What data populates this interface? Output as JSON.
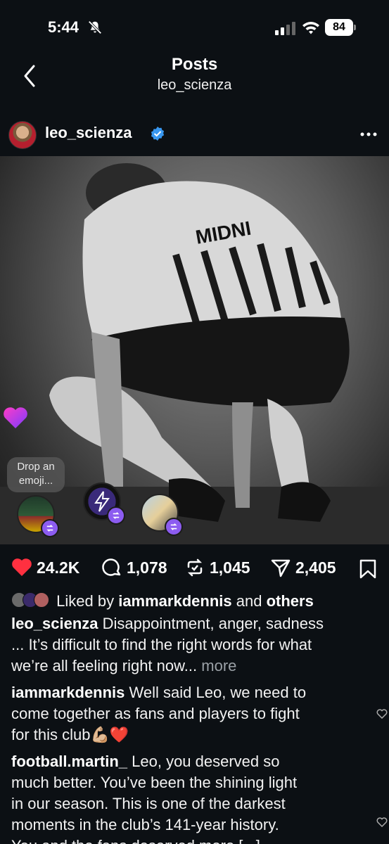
{
  "status_bar": {
    "time": "5:44",
    "battery": "84"
  },
  "header": {
    "title": "Posts",
    "subtitle": "leo_scienza"
  },
  "post": {
    "username": "leo_scienza",
    "image_text": "MIDNI",
    "emoji_prompt": "Drop an emoji...",
    "likes": "24.2K",
    "comments": "1,078",
    "reposts": "1,045",
    "shares": "2,405",
    "liked_by_prefix": "Liked by",
    "liked_by_user": "iammarkdennis",
    "liked_by_and": "and",
    "liked_by_others": "others",
    "caption_user": "leo_scienza",
    "caption_line1": "Disappointment, anger, sadness",
    "caption_line2": "... It’s difficult to find the right words for what",
    "caption_line3": "we’re all feeling right now...",
    "caption_more": "more"
  },
  "comments": [
    {
      "user": "iammarkdennis",
      "line1": "Well said Leo, we need to",
      "line2": "come together as fans and players to fight",
      "line3": "for this club💪🏼❤️"
    },
    {
      "user": "football.martin_",
      "line1": "Leo, you deserved so",
      "line2": "much better. You’ve been the shining light",
      "line3": "in our season. This is one of the darkest",
      "line4": "moments in the club’s 141-year history.",
      "line5": "You and the fans deserved more [...]"
    }
  ],
  "colors": {
    "background": "#0c1014",
    "like": "#ff3040",
    "badge": "#8c5cf0",
    "verified": "#3897f0"
  }
}
